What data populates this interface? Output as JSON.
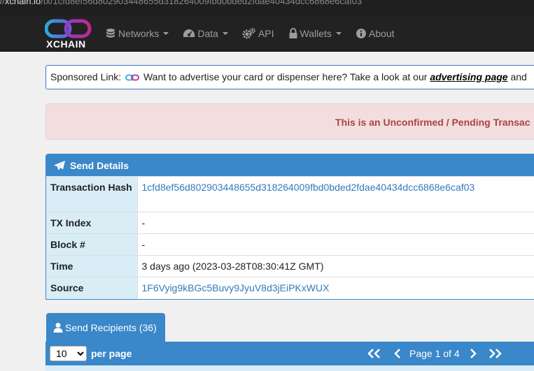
{
  "browser": {
    "url_host": "xchain.io",
    "url_path": "/tx/1cfd8ef56d802903448655d318264009fbd0bded2fdae40434dcc6868e6caf03"
  },
  "navbar": {
    "logo_text": "XCHAIN",
    "items": [
      {
        "label": "Networks",
        "icon": "database-icon",
        "dropdown": true
      },
      {
        "label": "Data",
        "icon": "dashboard-icon",
        "dropdown": true
      },
      {
        "label": "API",
        "icon": "cogs-icon",
        "dropdown": false
      },
      {
        "label": "Wallets",
        "icon": "lock-icon",
        "dropdown": true
      },
      {
        "label": "About",
        "icon": "info-circle-icon",
        "dropdown": false
      }
    ]
  },
  "sponsored": {
    "prefix": "Sponsored Link:",
    "message": "Want to advertise your card or dispenser here? Take a look at our",
    "link_text": "advertising page",
    "suffix": "and"
  },
  "alert": {
    "text": "This is an Unconfirmed / Pending Transac"
  },
  "send_details": {
    "title": "Send Details",
    "rows": [
      {
        "label": "Transaction Hash",
        "value": "1cfd8ef56d802903448655d318264009fbd0bded2fdae40434dcc6868e6caf03",
        "link": true
      },
      {
        "label": "TX Index",
        "value": "-",
        "link": false
      },
      {
        "label": "Block #",
        "value": "-",
        "link": false
      },
      {
        "label": "Time",
        "value": "3 days ago (2023-03-28T08:30:41Z GMT)",
        "link": false
      },
      {
        "label": "Source",
        "value": "1F6Vyig9kBGc5Buvy9JyuV8d3jEiPKxWUX",
        "link": true
      }
    ]
  },
  "recipients": {
    "tab_label": "Send Recipients (36)",
    "per_page_value": "10",
    "per_page_label": "per page",
    "page_info": "Page 1 of 4"
  },
  "colors": {
    "accent": "#3a87c9",
    "navbar": "#222222",
    "alert_bg": "#f2dede",
    "alert_text": "#a94442",
    "label_bg": "#d9edf7",
    "link": "#337ab7"
  }
}
